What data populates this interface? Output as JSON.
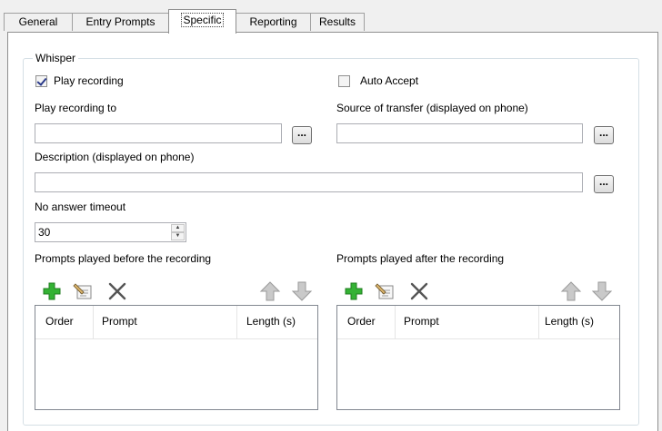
{
  "tabs": [
    {
      "label": "General"
    },
    {
      "label": "Entry Prompts"
    },
    {
      "label": "Specific",
      "active": true
    },
    {
      "label": "Reporting"
    },
    {
      "label": "Results"
    }
  ],
  "whisper": {
    "group_title": "Whisper",
    "play_recording": {
      "label": "Play recording",
      "checked": true
    },
    "auto_accept": {
      "label": "Auto Accept",
      "checked": false
    },
    "play_recording_to": {
      "label": "Play recording to",
      "value": ""
    },
    "source_of_transfer": {
      "label": "Source of transfer (displayed on phone)",
      "value": ""
    },
    "description": {
      "label": "Description (displayed on phone)",
      "value": ""
    },
    "browse_label": "...",
    "no_answer_timeout": {
      "label": "No answer timeout",
      "value": "30"
    },
    "prompts_before": {
      "label": "Prompts played before the recording",
      "columns": [
        "Order",
        "Prompt",
        "Length (s)"
      ],
      "rows": []
    },
    "prompts_after": {
      "label": "Prompts played after the recording",
      "columns": [
        "Order",
        "Prompt",
        "Length (s)"
      ],
      "rows": []
    }
  },
  "icons": {
    "add": "add-icon",
    "edit": "edit-icon",
    "delete": "delete-icon",
    "move_up": "arrow-up-icon",
    "move_down": "arrow-down-icon"
  },
  "colors": {
    "add_icon": "#2fa82f",
    "arrow_icon": "#a9a9a9",
    "delete_icon": "#555555"
  }
}
